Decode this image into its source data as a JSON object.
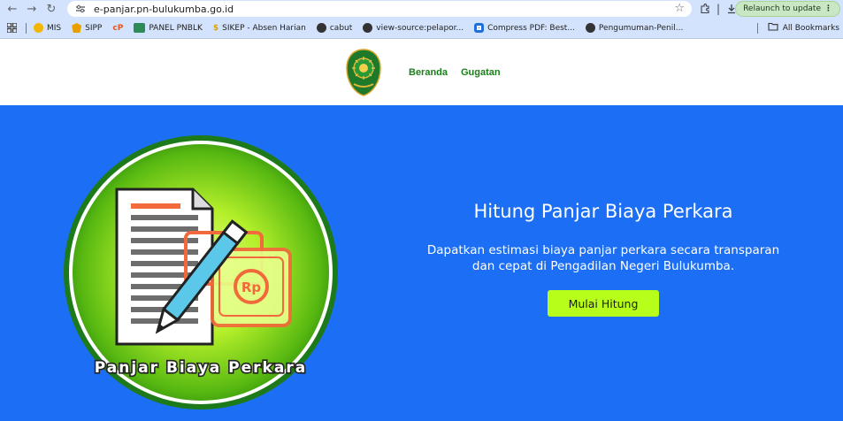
{
  "browser": {
    "url": "e-panjar.pn-bulukumba.go.id",
    "relaunch_label": "Relaunch to update",
    "bookmarks": [
      {
        "label": "MIS",
        "icon": "mis-icon",
        "color": "#f2b705"
      },
      {
        "label": "SIPP",
        "icon": "sipp-icon",
        "color": "#e8a000"
      },
      {
        "label": "",
        "icon": "cp-icon",
        "color": "#e8541b"
      },
      {
        "label": "PANEL PNBLK",
        "icon": "panel-icon",
        "color": "#2e8b57"
      },
      {
        "label": "SIKEP - Absen Harian",
        "icon": "sikep-icon",
        "color": "#d9a400"
      },
      {
        "label": "cabut",
        "icon": "globe-icon",
        "color": "#333333"
      },
      {
        "label": "view-source:pelapor...",
        "icon": "globe-icon",
        "color": "#333333"
      },
      {
        "label": "Compress PDF: Best...",
        "icon": "compress-icon",
        "color": "#1e6fd9"
      },
      {
        "label": "Pengumuman-Penil...",
        "icon": "globe-icon",
        "color": "#333333"
      }
    ],
    "all_bookmarks_label": "All Bookmarks"
  },
  "header": {
    "nav": [
      "Beranda",
      "Gugatan"
    ],
    "logo_icon": "court-emblem-icon"
  },
  "hero": {
    "title": "Hitung Panjar Biaya Perkara",
    "subtitle_line1": "Dapatkan estimasi biaya panjar perkara secara transparan",
    "subtitle_line2": "dan cepat di Pengadilan Negeri Bulukumba.",
    "cta_label": "Mulai Hitung",
    "illustration_caption": "Panjar Biaya Perkara",
    "illustration_currency": "Rp"
  },
  "colors": {
    "hero_bg": "#1c6ff4",
    "cta_bg": "#b7ff1a",
    "nav_green": "#1a7f1a",
    "chrome_bg": "#d3e3fd"
  }
}
